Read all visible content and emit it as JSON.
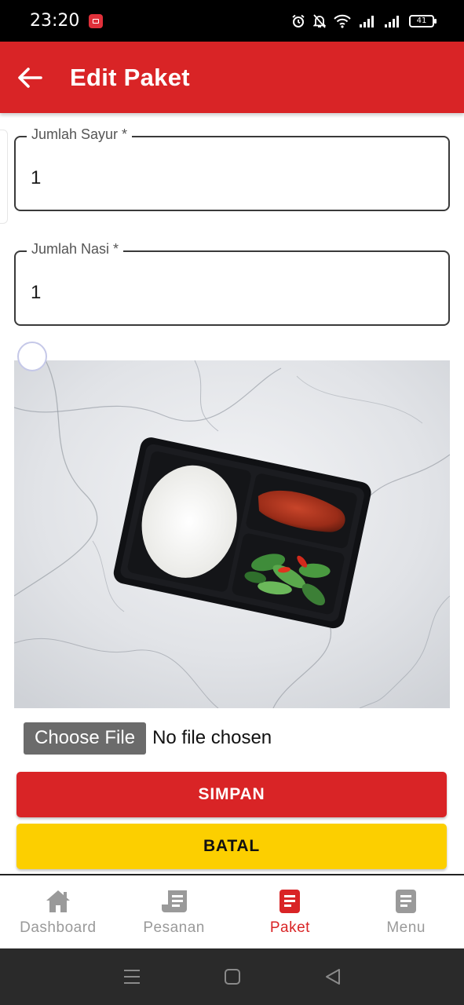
{
  "status_bar": {
    "time": "23:20",
    "battery_level": "41"
  },
  "app_bar": {
    "title": "Edit Paket"
  },
  "form": {
    "jumlah_sayur": {
      "label": "Jumlah Sayur *",
      "value": "1"
    },
    "jumlah_nasi": {
      "label": "Jumlah Nasi *",
      "value": "1"
    }
  },
  "file_input": {
    "button_label": "Choose File",
    "status_text": "No file chosen"
  },
  "actions": {
    "save_label": "SIMPAN",
    "cancel_label": "BATAL"
  },
  "bottom_nav": {
    "items": [
      {
        "label": "Dashboard",
        "icon": "home-icon",
        "active": false
      },
      {
        "label": "Pesanan",
        "icon": "receipt-icon",
        "active": false
      },
      {
        "label": "Paket",
        "icon": "document-icon",
        "active": true
      },
      {
        "label": "Menu",
        "icon": "document-icon",
        "active": false
      }
    ]
  },
  "colors": {
    "primary_red": "#d92426",
    "cancel_yellow": "#fccf00",
    "nav_inactive": "#9a9a9a"
  }
}
